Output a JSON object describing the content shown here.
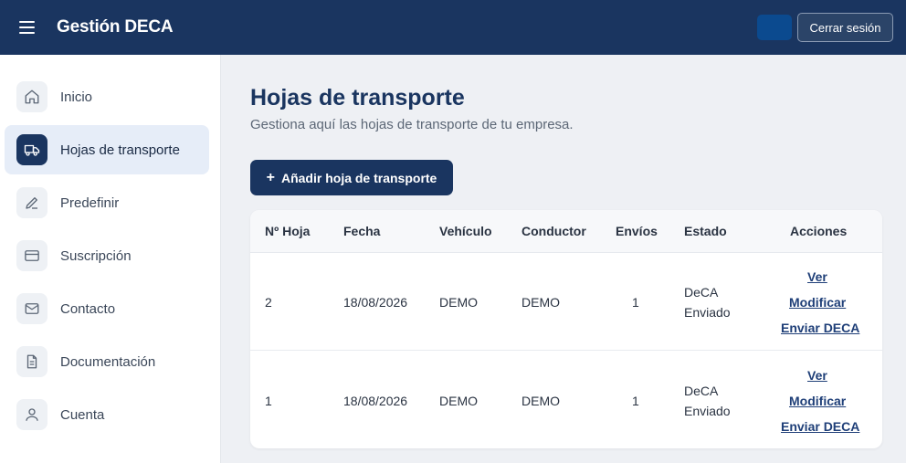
{
  "header": {
    "title": "Gestión DECA",
    "logout_label": "Cerrar sesión"
  },
  "sidebar": {
    "items": [
      {
        "label": "Inicio",
        "icon": "home-icon"
      },
      {
        "label": "Hojas de transporte",
        "icon": "truck-icon",
        "active": true
      },
      {
        "label": "Predefinir",
        "icon": "pencil-icon"
      },
      {
        "label": "Suscripción",
        "icon": "credit-card-icon"
      },
      {
        "label": "Contacto",
        "icon": "mail-icon"
      },
      {
        "label": "Documentación",
        "icon": "document-icon"
      },
      {
        "label": "Cuenta",
        "icon": "user-icon"
      }
    ]
  },
  "main": {
    "title": "Hojas de transporte",
    "subtitle": "Gestiona aquí las hojas de transporte de tu empresa.",
    "add_button_label": "Añadir hoja de transporte",
    "table": {
      "headers": [
        "Nº Hoja",
        "Fecha",
        "Vehículo",
        "Conductor",
        "Envíos",
        "Estado",
        "Acciones"
      ],
      "rows": [
        {
          "numero": "2",
          "fecha": "18/08/2026",
          "vehiculo": "DEMO",
          "conductor": "DEMO",
          "envios": "1",
          "estado_1": "DeCA",
          "estado_2": "Enviado",
          "actions": [
            "Ver",
            "Modificar",
            "Enviar DECA"
          ]
        },
        {
          "numero": "1",
          "fecha": "18/08/2026",
          "vehiculo": "DEMO",
          "conductor": "DEMO",
          "envios": "1",
          "estado_1": "DeCA",
          "estado_2": "Enviado",
          "actions": [
            "Ver",
            "Modificar",
            "Enviar DECA"
          ]
        }
      ]
    }
  },
  "colors": {
    "primary": "#1a3560",
    "link": "#1f3f78",
    "background": "#eef0f4"
  }
}
